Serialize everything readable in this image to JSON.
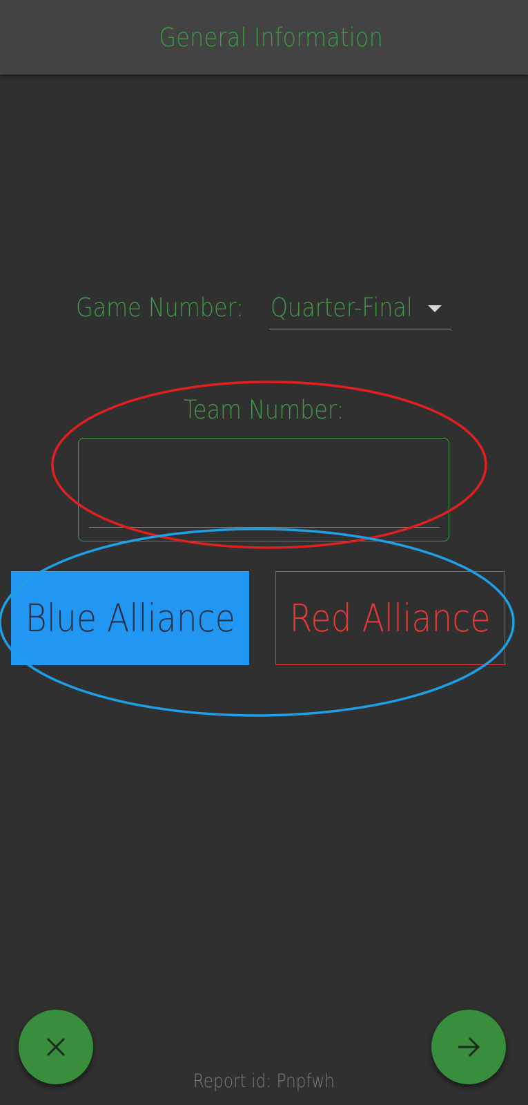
{
  "app_bar": {
    "title": "General Information"
  },
  "form": {
    "game_number_label": "Game Number:",
    "game_number_value": "Quarter-Final",
    "team_number_label": "Team Number:",
    "team_number_value": ""
  },
  "alliance": {
    "blue_label": "Blue Alliance",
    "red_label": "Red Alliance"
  },
  "fabs": {
    "cancel_icon": "close-icon",
    "next_icon": "arrow-right-icon"
  },
  "footer": {
    "report_id": "Report id: Pnpfwh"
  },
  "colors": {
    "background": "#303030",
    "app_bar": "#434343",
    "accent_green": "#3e9a45",
    "fab_green": "#388e3c",
    "blue_alliance": "#2196f3",
    "red_alliance": "#e53935",
    "annotation_red": "#e02020",
    "annotation_blue": "#1ea0e6"
  }
}
